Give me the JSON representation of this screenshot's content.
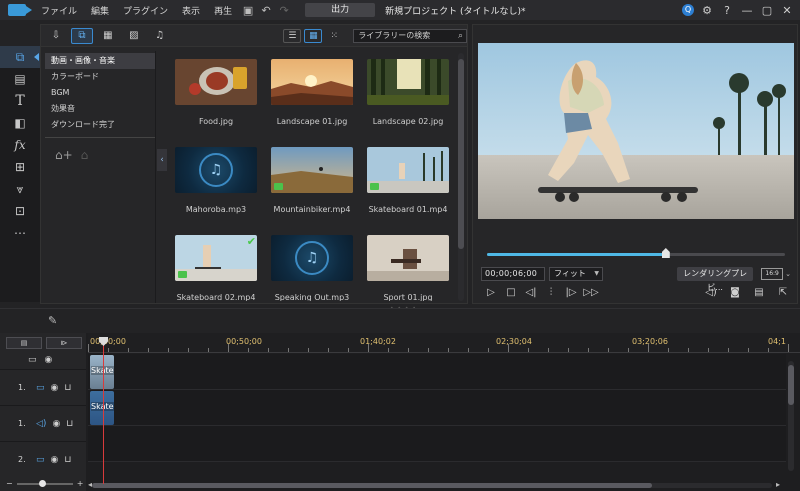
{
  "menubar": {
    "menus": [
      "ファイル",
      "編集",
      "プラグイン",
      "表示",
      "再生"
    ],
    "output_label": "出力",
    "project_title": "新規プロジェクト (タイトルなし)*",
    "badge": "Q",
    "help": "?"
  },
  "library": {
    "search_placeholder": "ライブラリーの検索",
    "categories": [
      "動画・画像・音楽",
      "カラーボード",
      "BGM",
      "効果音",
      "ダウンロード完了"
    ],
    "items": [
      {
        "label": "Food.jpg"
      },
      {
        "label": "Landscape 01.jpg"
      },
      {
        "label": "Landscape 02.jpg"
      },
      {
        "label": "Mahoroba.mp3"
      },
      {
        "label": "Mountainbiker.mp4"
      },
      {
        "label": "Skateboard 01.mp4"
      },
      {
        "label": "Skateboard 02.mp4"
      },
      {
        "label": "Speaking Out.mp3"
      },
      {
        "label": "Sport 01.jpg"
      }
    ]
  },
  "preview": {
    "timecode": "00;00;06;00",
    "fit": "フィット",
    "render_label": "レンダリングプレビ...",
    "ratio": "16:9",
    "progress": 0.6
  },
  "timeline": {
    "ruler": [
      "00;00;00",
      "00;50;00",
      "01;40;02",
      "02;30;04",
      "03;20;06",
      "04;1"
    ],
    "tracks": [
      {
        "num": "1.",
        "type": "video",
        "clip": "Skate"
      },
      {
        "num": "1.",
        "type": "audio",
        "clip": "Skate"
      },
      {
        "num": "2.",
        "type": "video",
        "clip": ""
      }
    ]
  },
  "colors": {
    "accent": "#3a9ad9",
    "playhead": "#d83b3b",
    "ruler_text": "#e0c070"
  }
}
